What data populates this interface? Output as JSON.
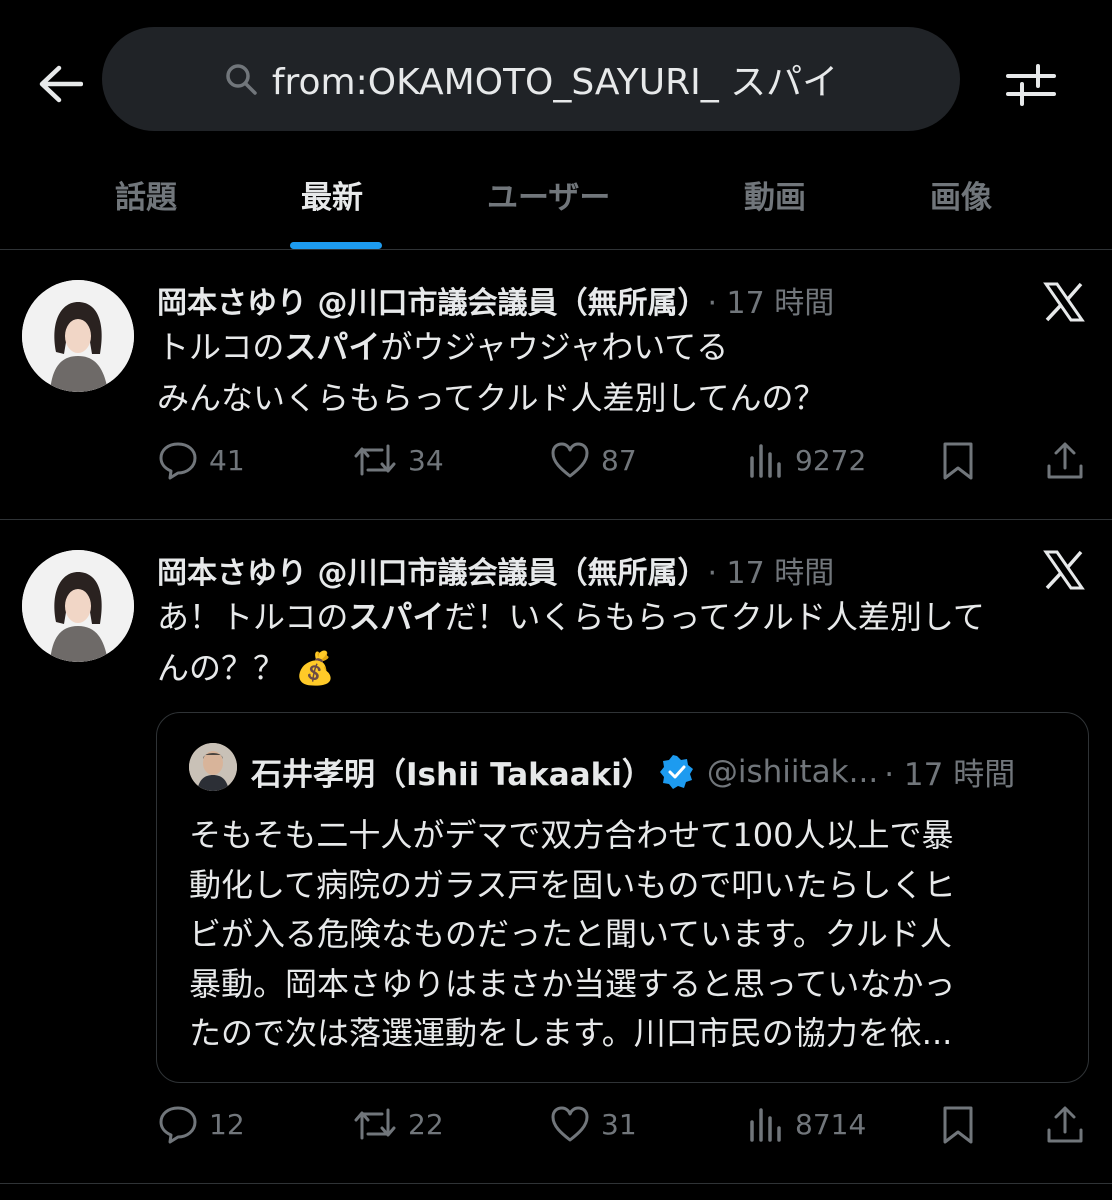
{
  "search": {
    "query": "from:OKAMOTO_SAYURI_ スパイ"
  },
  "tabs": [
    {
      "label": "話題"
    },
    {
      "label": "最新"
    },
    {
      "label": "ユーザー"
    },
    {
      "label": "動画"
    },
    {
      "label": "画像"
    }
  ],
  "active_tab": "最新",
  "posts": [
    {
      "author": "岡本さゆり @川口市議会議員（無所属）",
      "time": "· 17 時間",
      "body_line1_pre": "トルコの",
      "body_line1_em": "スパイ",
      "body_line1_post": "がウジャウジャわいてる",
      "body_line2": "みんないくらもらってクルド人差別してんの？",
      "replies": "41",
      "reposts": "34",
      "likes": "87",
      "views": "9272"
    },
    {
      "author": "岡本さゆり @川口市議会議員（無所属）",
      "time": "· 17 時間",
      "body_line1_pre": "あ！トルコの",
      "body_line1_em": "スパイ",
      "body_line1_post": "だ！いくらもらってクルド人差別して",
      "body_line2": "んの？？",
      "emoji": "💰",
      "replies": "12",
      "reposts": "22",
      "likes": "31",
      "views": "8714"
    }
  ],
  "quote": {
    "name": "石井孝明（Ishii Takaaki）",
    "handle": "@ishiitak...",
    "time": "· 17 時間",
    "lines": [
      "そもそも二十人がデマで双方合わせて100人以上で暴",
      "動化して病院のガラス戸を固いもので叩いたらしくヒ",
      "ビが入る危険なものだったと聞いています。クルド人",
      "暴動。岡本さゆりはまさか当選すると思っていなかっ",
      "たので次は落選運動をします。川口市民の協力を依..."
    ]
  },
  "colors": {
    "background": "#000000",
    "text": "#e7e9ea",
    "muted": "#71767b",
    "accent": "#1d9bf0",
    "search_bg": "#202327",
    "border": "#2f3336"
  },
  "icons": [
    "back-arrow-icon",
    "search-icon",
    "filter-icon",
    "x-logo-icon",
    "reply-icon",
    "repost-icon",
    "like-icon",
    "views-icon",
    "bookmark-icon",
    "share-icon",
    "verified-icon",
    "money-bag-icon"
  ]
}
